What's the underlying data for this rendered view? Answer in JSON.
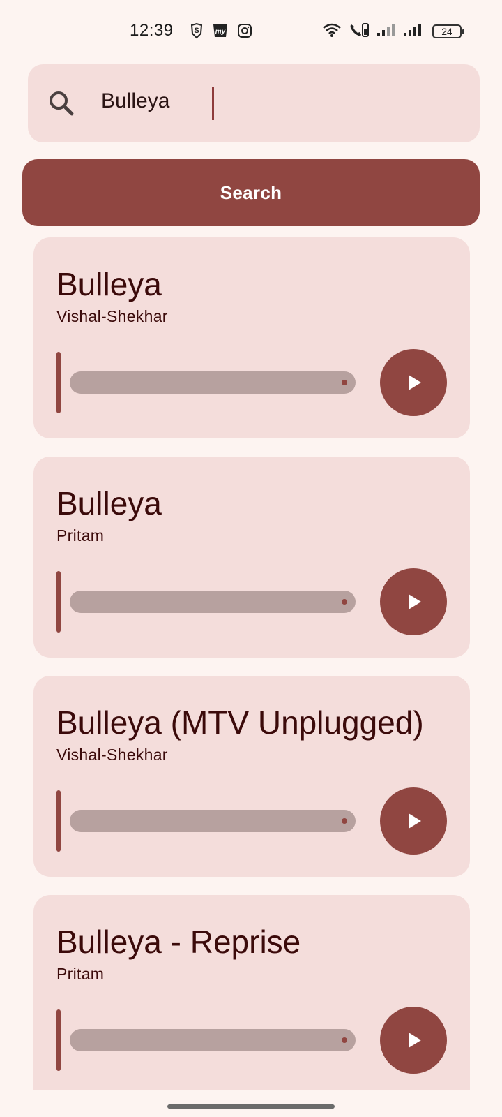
{
  "status_bar": {
    "time": "12:39",
    "battery": "24",
    "left_icons": [
      "shield-s-icon",
      "myntra-icon",
      "instagram-icon"
    ],
    "right_icons": [
      "wifi-icon",
      "call-icon",
      "signal-icon",
      "signal-icon"
    ]
  },
  "search": {
    "value": "Bulleya",
    "button_label": "Search"
  },
  "colors": {
    "background": "#fdf4f1",
    "surface": "#f4dddb",
    "accent": "#904641",
    "track": "#b7a19f",
    "text": "#3b0a0a"
  },
  "results": [
    {
      "title": "Bulleya",
      "artist": "Vishal-Shekhar"
    },
    {
      "title": "Bulleya",
      "artist": "Pritam"
    },
    {
      "title": "Bulleya (MTV Unplugged)",
      "artist": "Vishal-Shekhar"
    },
    {
      "title": "Bulleya - Reprise",
      "artist": "Pritam"
    }
  ]
}
